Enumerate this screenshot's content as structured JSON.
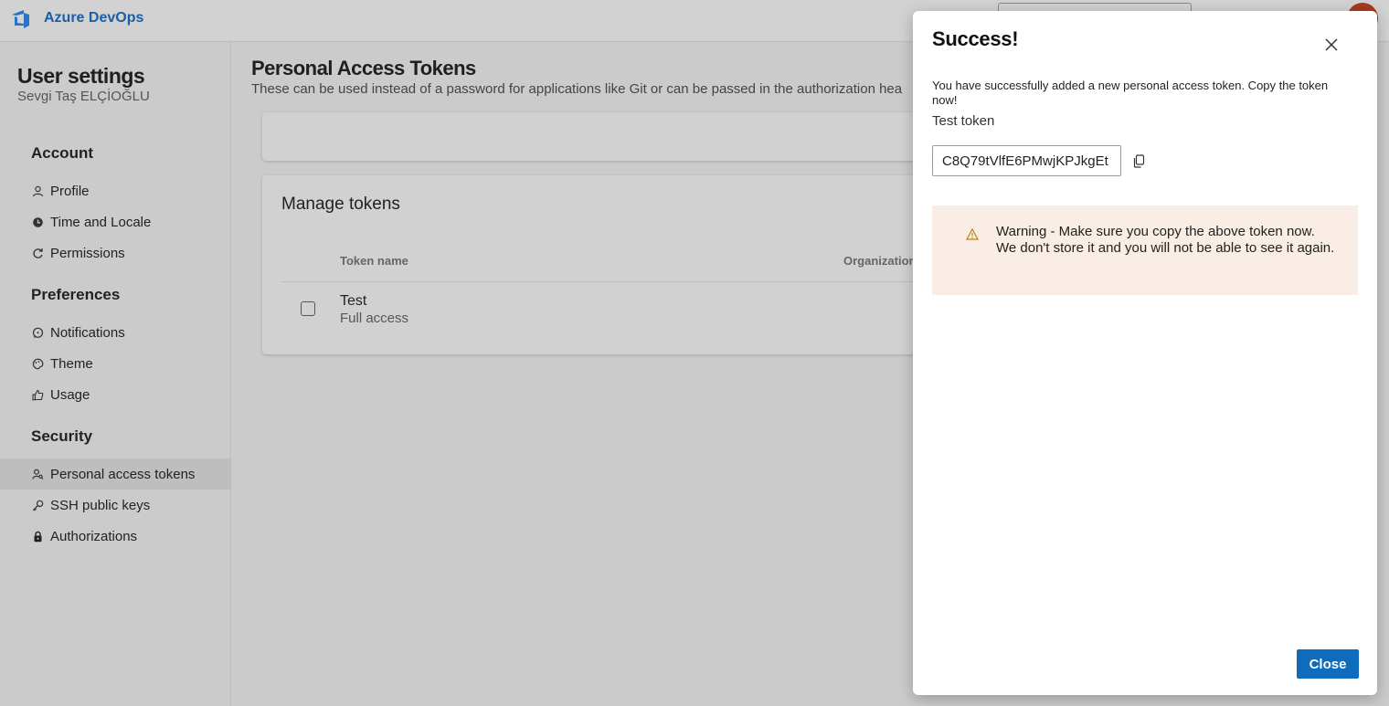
{
  "app": {
    "brand": "Azure DevOps",
    "accent_color": "#0f6cbd"
  },
  "sidebar": {
    "title": "User settings",
    "user": "Sevgi Taş ELÇİOĞLU",
    "sections": [
      {
        "label": "Account",
        "items": [
          {
            "label": "Profile",
            "icon": "person-icon"
          },
          {
            "label": "Time and Locale",
            "icon": "clock-globe-icon"
          },
          {
            "label": "Permissions",
            "icon": "refresh-icon"
          }
        ]
      },
      {
        "label": "Preferences",
        "items": [
          {
            "label": "Notifications",
            "icon": "chat-bubble-icon"
          },
          {
            "label": "Theme",
            "icon": "palette-icon"
          },
          {
            "label": "Usage",
            "icon": "thumbs-up-icon"
          }
        ]
      },
      {
        "label": "Security",
        "items": [
          {
            "label": "Personal access tokens",
            "icon": "person-key-icon",
            "selected": true
          },
          {
            "label": "SSH public keys",
            "icon": "key-icon"
          },
          {
            "label": "Authorizations",
            "icon": "lock-icon"
          }
        ]
      }
    ]
  },
  "main": {
    "title": "Personal Access Tokens",
    "subtitle": "These can be used instead of a password for applications like Git or can be passed in the authorization hea",
    "manage": {
      "title": "Manage tokens",
      "columns": [
        "Token name",
        "Organization"
      ],
      "rows": [
        {
          "name": "Test",
          "scope": "Full access"
        }
      ]
    }
  },
  "panel": {
    "title": "Success!",
    "message": "You have successfully added a new personal access token. Copy the token now!",
    "token_name": "Test token",
    "token_value": "C8Q79tVlfE6PMwjKPJkgEt",
    "warning": "Warning - Make sure you copy the above token now. We don't store it and you will not be able to see it again.",
    "close_label": "Close"
  }
}
